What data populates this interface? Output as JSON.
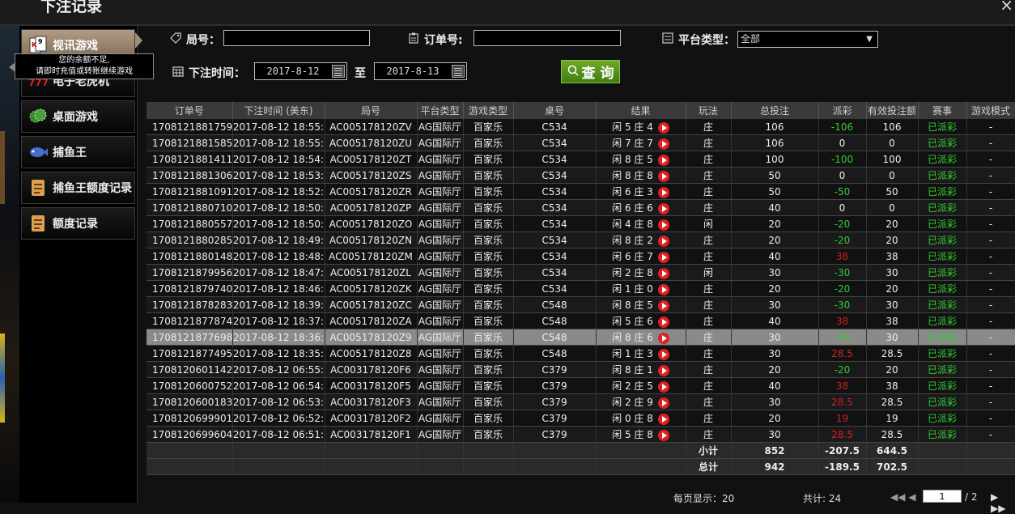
{
  "window": {
    "title": "下注记录",
    "close_label": "×"
  },
  "tooltip": {
    "line1": "您的余额不足,",
    "line2": "请即时充值或转账继续游戏"
  },
  "sidebar": {
    "items": [
      {
        "label": "视讯游戏",
        "icon": "playing-card-icon"
      },
      {
        "label": "电子老虎机",
        "icon": "slot-777-icon"
      },
      {
        "label": "桌面游戏",
        "icon": "chips-icon"
      },
      {
        "label": "捕鱼王",
        "icon": "fish-icon"
      },
      {
        "label": "捕鱼王额度记录",
        "icon": "document-icon"
      },
      {
        "label": "额度记录",
        "icon": "document-icon"
      }
    ]
  },
  "filters": {
    "round_label": "局号：",
    "round_value": "",
    "order_label": "订单号:",
    "order_value": "",
    "platform_label": "平台类型：",
    "platform_value": "全部",
    "time_label": "下注时间：",
    "date_from": "2017-8-12",
    "to_label": "至",
    "date_to": "2017-8-13",
    "query_label": "查 询"
  },
  "table": {
    "headers": [
      "订单号",
      "下注时间 (美东)",
      "局号",
      "平台类型",
      "游戏类型",
      "桌号",
      "结果",
      "玩法",
      "总投注",
      "派彩",
      "有效投注额",
      "赛事",
      "游戏模式"
    ],
    "rows": [
      {
        "id": "1708121881759",
        "time": "2017-08-12 18:55:",
        "round": "AC005178120ZV",
        "platform": "AG国际厅",
        "game": "百家乐",
        "table": "C534",
        "result": "闲 5 庄 4",
        "play": "庄",
        "bet": "106",
        "payout": "-106",
        "pc": "green",
        "valid": "106",
        "status": "已派彩",
        "mode": "-"
      },
      {
        "id": "1708121881585",
        "time": "2017-08-12 18:55:",
        "round": "AC005178120ZU",
        "platform": "AG国际厅",
        "game": "百家乐",
        "table": "C534",
        "result": "闲 7 庄 7",
        "play": "庄",
        "bet": "106",
        "payout": "0",
        "pc": "",
        "valid": "0",
        "status": "已派彩",
        "mode": "-"
      },
      {
        "id": "1708121881411",
        "time": "2017-08-12 18:54:",
        "round": "AC005178120ZT",
        "platform": "AG国际厅",
        "game": "百家乐",
        "table": "C534",
        "result": "闲 8 庄 5",
        "play": "庄",
        "bet": "100",
        "payout": "-100",
        "pc": "green",
        "valid": "100",
        "status": "已派彩",
        "mode": "-"
      },
      {
        "id": "1708121881306",
        "time": "2017-08-12 18:53:",
        "round": "AC005178120ZS",
        "platform": "AG国际厅",
        "game": "百家乐",
        "table": "C534",
        "result": "闲 8 庄 8",
        "play": "庄",
        "bet": "50",
        "payout": "0",
        "pc": "",
        "valid": "0",
        "status": "已派彩",
        "mode": "-"
      },
      {
        "id": "1708121881091",
        "time": "2017-08-12 18:52:",
        "round": "AC005178120ZR",
        "platform": "AG国际厅",
        "game": "百家乐",
        "table": "C534",
        "result": "闲 6 庄 3",
        "play": "庄",
        "bet": "50",
        "payout": "-50",
        "pc": "green",
        "valid": "50",
        "status": "已派彩",
        "mode": "-"
      },
      {
        "id": "1708121880710",
        "time": "2017-08-12 18:50:",
        "round": "AC005178120ZP",
        "platform": "AG国际厅",
        "game": "百家乐",
        "table": "C534",
        "result": "闲 6 庄 6",
        "play": "庄",
        "bet": "40",
        "payout": "0",
        "pc": "",
        "valid": "0",
        "status": "已派彩",
        "mode": "-"
      },
      {
        "id": "1708121880557",
        "time": "2017-08-12 18:50:",
        "round": "AC005178120ZO",
        "platform": "AG国际厅",
        "game": "百家乐",
        "table": "C534",
        "result": "闲 4 庄 8",
        "play": "闲",
        "bet": "20",
        "payout": "-20",
        "pc": "green",
        "valid": "20",
        "status": "已派彩",
        "mode": "-"
      },
      {
        "id": "1708121880285",
        "time": "2017-08-12 18:49:",
        "round": "AC005178120ZN",
        "platform": "AG国际厅",
        "game": "百家乐",
        "table": "C534",
        "result": "闲 8 庄 2",
        "play": "庄",
        "bet": "20",
        "payout": "-20",
        "pc": "green",
        "valid": "20",
        "status": "已派彩",
        "mode": "-"
      },
      {
        "id": "1708121880148",
        "time": "2017-08-12 18:48:",
        "round": "AC005178120ZM",
        "platform": "AG国际厅",
        "game": "百家乐",
        "table": "C534",
        "result": "闲 6 庄 7",
        "play": "庄",
        "bet": "40",
        "payout": "38",
        "pc": "red",
        "valid": "38",
        "status": "已派彩",
        "mode": "-"
      },
      {
        "id": "1708121879956",
        "time": "2017-08-12 18:47:",
        "round": "AC005178120ZL",
        "platform": "AG国际厅",
        "game": "百家乐",
        "table": "C534",
        "result": "闲 2 庄 8",
        "play": "闲",
        "bet": "30",
        "payout": "-30",
        "pc": "green",
        "valid": "30",
        "status": "已派彩",
        "mode": "-"
      },
      {
        "id": "1708121879740",
        "time": "2017-08-12 18:46:",
        "round": "AC005178120ZK",
        "platform": "AG国际厅",
        "game": "百家乐",
        "table": "C534",
        "result": "闲 1 庄 0",
        "play": "庄",
        "bet": "20",
        "payout": "-20",
        "pc": "green",
        "valid": "20",
        "status": "已派彩",
        "mode": "-"
      },
      {
        "id": "1708121878283",
        "time": "2017-08-12 18:39:",
        "round": "AC005178120ZC",
        "platform": "AG国际厅",
        "game": "百家乐",
        "table": "C548",
        "result": "闲 8 庄 5",
        "play": "庄",
        "bet": "30",
        "payout": "-30",
        "pc": "green",
        "valid": "30",
        "status": "已派彩",
        "mode": "-"
      },
      {
        "id": "1708121877874",
        "time": "2017-08-12 18:37:",
        "round": "AC005178120ZA",
        "platform": "AG国际厅",
        "game": "百家乐",
        "table": "C548",
        "result": "闲 5 庄 6",
        "play": "庄",
        "bet": "40",
        "payout": "38",
        "pc": "red",
        "valid": "38",
        "status": "已派彩",
        "mode": "-"
      },
      {
        "id": "1708121877698",
        "time": "2017-08-12 18:36:",
        "round": "AC005178120Z9",
        "platform": "AG国际厅",
        "game": "百家乐",
        "table": "C548",
        "result": "闲 8 庄 6",
        "play": "庄",
        "bet": "30",
        "payout": "-30",
        "pc": "green",
        "valid": "30",
        "status": "已派彩",
        "mode": "-",
        "selected": true
      },
      {
        "id": "1708121877495",
        "time": "2017-08-12 18:35:",
        "round": "AC005178120Z8",
        "platform": "AG国际厅",
        "game": "百家乐",
        "table": "C548",
        "result": "闲 1 庄 3",
        "play": "庄",
        "bet": "30",
        "payout": "28.5",
        "pc": "red",
        "valid": "28.5",
        "status": "已派彩",
        "mode": "-"
      },
      {
        "id": "1708120601142",
        "time": "2017-08-12 06:55:",
        "round": "AC003178120F6",
        "platform": "AG国际厅",
        "game": "百家乐",
        "table": "C379",
        "result": "闲 8 庄 1",
        "play": "庄",
        "bet": "20",
        "payout": "-20",
        "pc": "green",
        "valid": "20",
        "status": "已派彩",
        "mode": "-"
      },
      {
        "id": "1708120600752",
        "time": "2017-08-12 06:54:",
        "round": "AC003178120F5",
        "platform": "AG国际厅",
        "game": "百家乐",
        "table": "C379",
        "result": "闲 2 庄 5",
        "play": "庄",
        "bet": "40",
        "payout": "38",
        "pc": "red",
        "valid": "38",
        "status": "已派彩",
        "mode": "-"
      },
      {
        "id": "1708120600183",
        "time": "2017-08-12 06:53:",
        "round": "AC003178120F3",
        "platform": "AG国际厅",
        "game": "百家乐",
        "table": "C379",
        "result": "闲 2 庄 9",
        "play": "庄",
        "bet": "30",
        "payout": "28.5",
        "pc": "red",
        "valid": "28.5",
        "status": "已派彩",
        "mode": "-"
      },
      {
        "id": "1708120699901",
        "time": "2017-08-12 06:52:",
        "round": "AC003178120F2",
        "platform": "AG国际厅",
        "game": "百家乐",
        "table": "C379",
        "result": "闲 0 庄 8",
        "play": "庄",
        "bet": "20",
        "payout": "19",
        "pc": "red",
        "valid": "19",
        "status": "已派彩",
        "mode": "-"
      },
      {
        "id": "1708120699604",
        "time": "2017-08-12 06:51:",
        "round": "AC003178120F1",
        "platform": "AG国际厅",
        "game": "百家乐",
        "table": "C379",
        "result": "闲 5 庄 8",
        "play": "庄",
        "bet": "30",
        "payout": "28.5",
        "pc": "red",
        "valid": "28.5",
        "status": "已派彩",
        "mode": "-"
      }
    ],
    "subtotal": {
      "label": "小计",
      "bet": "852",
      "payout": "-207.5",
      "valid": "644.5"
    },
    "total": {
      "label": "总计",
      "bet": "942",
      "payout": "-189.5",
      "valid": "702.5"
    }
  },
  "pager": {
    "per_page": "每页显示：20",
    "total": "共计: 24",
    "page": "1",
    "page_count": "/ 2"
  },
  "colors": {
    "accent_green": "#5a9a1f",
    "payout_positive": "#33cc33",
    "payout_negative": "#cc2222",
    "total_text": "#f0c000"
  }
}
